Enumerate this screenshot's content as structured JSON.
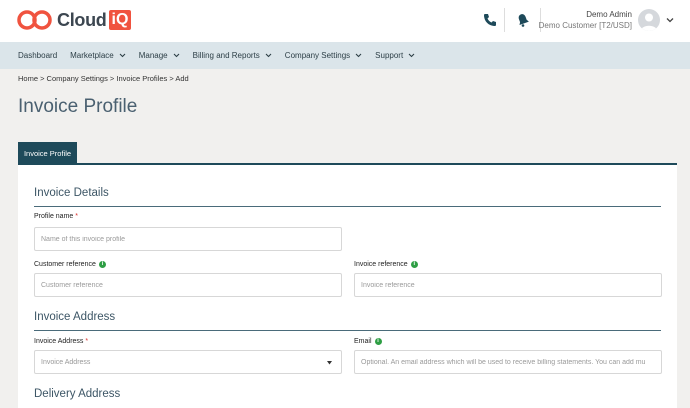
{
  "brand": {
    "name": "Cloud",
    "badge": "iQ",
    "accent": "#f0533f"
  },
  "user": {
    "name": "Demo Admin",
    "customer": "Demo Customer [T2/USD]"
  },
  "header_icons": [
    "phone-icon",
    "bell-icon",
    "user-avatar-icon",
    "chevron-down-icon"
  ],
  "nav": {
    "items": [
      {
        "label": "Dashboard"
      },
      {
        "label": "Marketplace"
      },
      {
        "label": "Manage"
      },
      {
        "label": "Billing and Reports"
      },
      {
        "label": "Company Settings"
      },
      {
        "label": "Support"
      }
    ]
  },
  "breadcrumb": "Home > Company Settings > Invoice Profiles > Add",
  "page_title": "Invoice Profile",
  "tab": "Invoice Profile",
  "sections": {
    "details": "Invoice Details",
    "address": "Invoice Address",
    "delivery": "Delivery Address"
  },
  "form": {
    "profile_name": {
      "label": "Profile name",
      "required": "*",
      "placeholder": "Name of this invoice profile"
    },
    "customer_reference": {
      "label": "Customer reference",
      "placeholder": "Customer reference"
    },
    "invoice_reference": {
      "label": "Invoice reference",
      "placeholder": "Invoice reference"
    },
    "invoice_address": {
      "label": "Invoice Address",
      "required": "*",
      "placeholder": "Invoice Address"
    },
    "email": {
      "label": "Email",
      "placeholder": "Optional. An email address which will be used to receive billing statements. You can add mu"
    }
  }
}
